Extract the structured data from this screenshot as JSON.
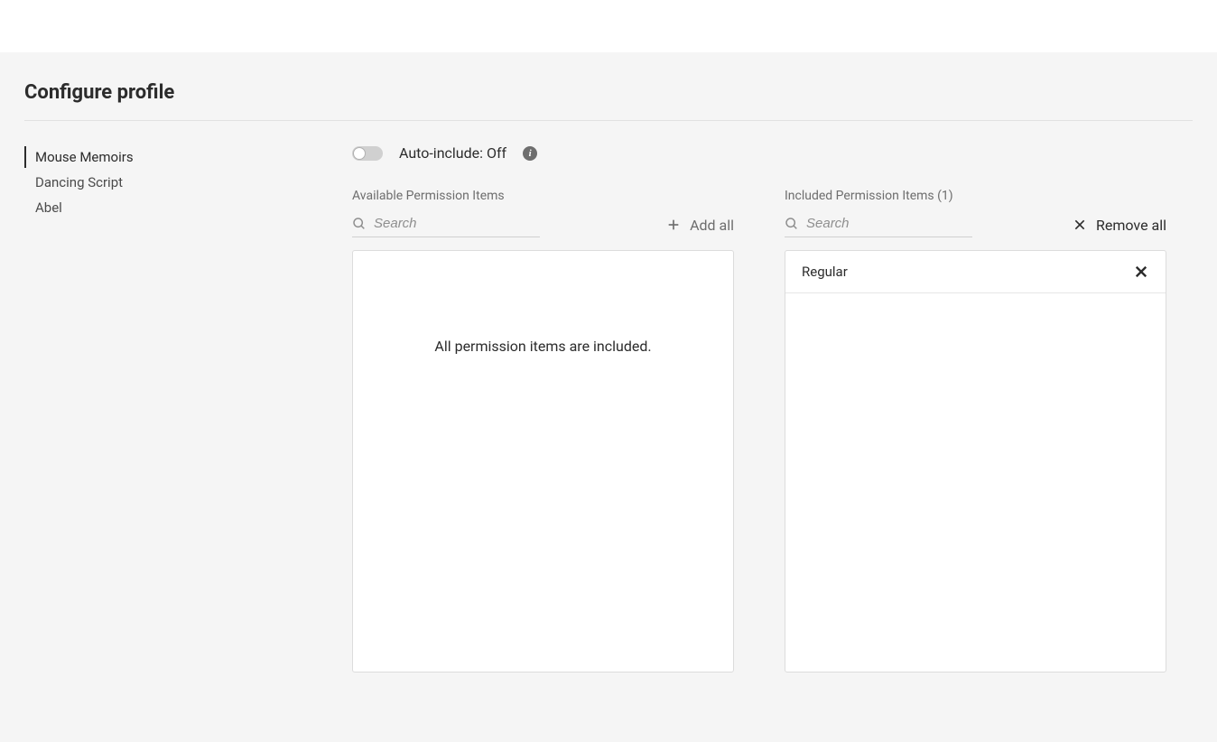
{
  "page": {
    "title": "Configure profile"
  },
  "sidebar": {
    "items": [
      {
        "label": "Mouse Memoirs",
        "active": true
      },
      {
        "label": "Dancing Script",
        "active": false
      },
      {
        "label": "Abel",
        "active": false
      }
    ]
  },
  "toggle": {
    "label": "Auto-include: Off",
    "state": "off"
  },
  "available": {
    "header": "Available Permission Items",
    "search_placeholder": "Search",
    "add_all_label": "Add all",
    "empty_message": "All permission items are included."
  },
  "included": {
    "header": "Included Permission Items (1)",
    "search_placeholder": "Search",
    "remove_all_label": "Remove all",
    "items": [
      {
        "label": "Regular"
      }
    ]
  }
}
